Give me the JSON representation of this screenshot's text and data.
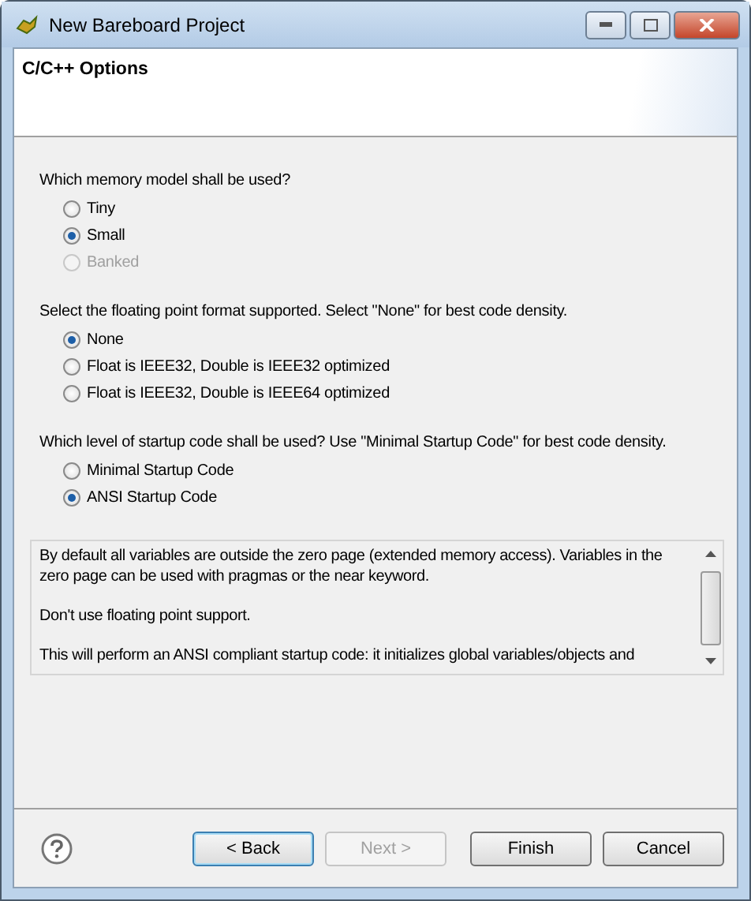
{
  "window": {
    "title": "New Bareboard Project"
  },
  "header": {
    "title": "C/C++ Options"
  },
  "groups": [
    {
      "question": "Which memory model shall be used?",
      "options": [
        {
          "label": "Tiny",
          "selected": false,
          "disabled": false
        },
        {
          "label": "Small",
          "selected": true,
          "disabled": false
        },
        {
          "label": "Banked",
          "selected": false,
          "disabled": true
        }
      ]
    },
    {
      "question": "Select the floating point format supported. Select \"None\" for best code density.",
      "options": [
        {
          "label": "None",
          "selected": true,
          "disabled": false
        },
        {
          "label": "Float is IEEE32, Double is IEEE32 optimized",
          "selected": false,
          "disabled": false
        },
        {
          "label": "Float is IEEE32, Double is IEEE64 optimized",
          "selected": false,
          "disabled": false
        }
      ]
    },
    {
      "question": "Which level of startup code shall be used? Use \"Minimal Startup Code\" for best code density.",
      "options": [
        {
          "label": "Minimal Startup Code",
          "selected": false,
          "disabled": false
        },
        {
          "label": "ANSI Startup Code",
          "selected": true,
          "disabled": false
        }
      ]
    }
  ],
  "description": [
    "By default all variables are outside the zero page (extended memory access). Variables in the zero page can be used with pragmas or the near keyword.",
    "Don't use floating point support.",
    "This will perform an ANSI compliant startup code: it initializes global variables/objects and"
  ],
  "buttons": [
    {
      "label": "< Back",
      "disabled": false,
      "focused": true
    },
    {
      "label": "Next >",
      "disabled": true,
      "focused": false
    },
    {
      "label": "Finish",
      "disabled": false,
      "focused": false
    },
    {
      "label": "Cancel",
      "disabled": false,
      "focused": false
    }
  ]
}
